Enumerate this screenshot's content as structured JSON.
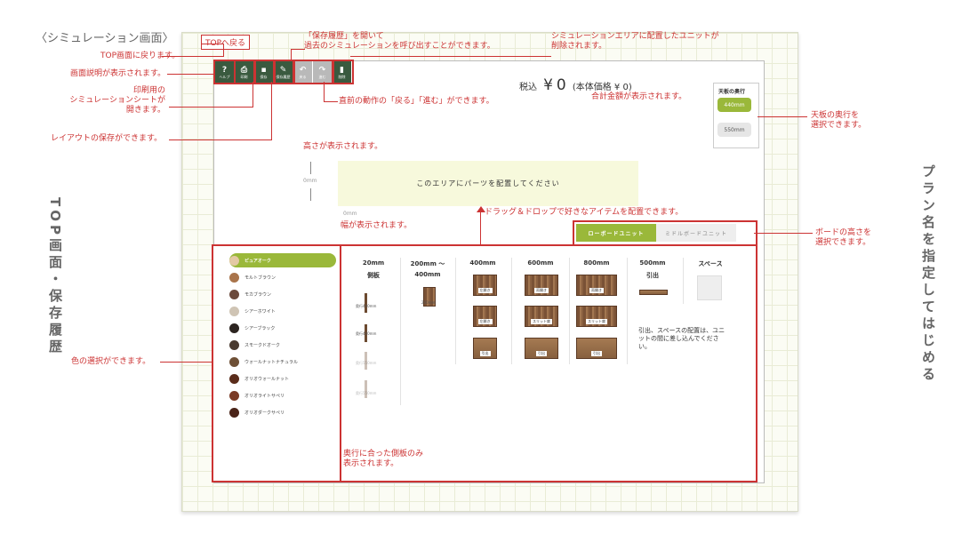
{
  "page_title": "〈シミュレーション画面〉",
  "left_vertical_label": "TOP画面・保存履歴",
  "right_vertical_label": "プラン名を指定してはじめる",
  "top_button": "TOPへ戻る",
  "toolbar": [
    {
      "icon": "help-icon",
      "glyph": "?",
      "label": "ヘルプ"
    },
    {
      "icon": "print-icon",
      "glyph": "⎙",
      "label": "印刷"
    },
    {
      "icon": "save-icon",
      "glyph": "▪",
      "label": "保存"
    },
    {
      "icon": "history-icon",
      "glyph": "✎",
      "label": "保存履歴"
    },
    {
      "icon": "undo-icon",
      "glyph": "↶",
      "label": "戻る"
    },
    {
      "icon": "redo-icon",
      "glyph": "↷",
      "label": "進む"
    },
    {
      "icon": "trash-icon",
      "glyph": "▮",
      "label": "削除"
    }
  ],
  "price": {
    "prefix": "税込",
    "symbol": "¥",
    "value": "0",
    "detail": "(本体価格 ¥ 0)"
  },
  "depth": {
    "title": "天板の奥行",
    "option1": "440mm",
    "option2": "550mm"
  },
  "canvas": {
    "height_label": "0mm",
    "width_label": "0mm",
    "drop_text": "このエリアにパーツを配置してください"
  },
  "tabs": [
    "ローボードユニット",
    "ミドルボードユニット"
  ],
  "colors": [
    {
      "name": "ピュアオーク",
      "color": "#e3c9a4"
    },
    {
      "name": "モルトブラウン",
      "color": "#a9744b"
    },
    {
      "name": "モカブラウン",
      "color": "#6b4a3c"
    },
    {
      "name": "シアーホワイト",
      "color": "#cfc4b4"
    },
    {
      "name": "シアーブラック",
      "color": "#2c2420"
    },
    {
      "name": "スモークドオーク",
      "color": "#4a3a30"
    },
    {
      "name": "ウォールナットナチュラル",
      "color": "#6e5036"
    },
    {
      "name": "オリオウォールナット",
      "color": "#5a2c1a"
    },
    {
      "name": "オリオライトサペリ",
      "color": "#7a3a24"
    },
    {
      "name": "オリオダークサペリ",
      "color": "#4a2418"
    }
  ],
  "parts": {
    "headers": [
      "20mm",
      "200mm ～",
      "400mm",
      "600mm",
      "800mm",
      "500mm",
      "スペース"
    ],
    "sub_headers": [
      "側板",
      "400mm",
      "引出"
    ],
    "side_labels": [
      "奥行440mm",
      "奥行440mm",
      "奥行550mm",
      "奥行550mm"
    ],
    "board_label": "200mm",
    "unit_labels": {
      "r1": [
        "左開き",
        "両開き",
        "両開き"
      ],
      "r2": [
        "左開き",
        "スリット扉",
        "スリット扉"
      ],
      "r3": [
        "引出",
        "引出",
        "引出"
      ]
    },
    "note": "引出、スペースの配置は、ユニットの間に差し込んでください。"
  },
  "annotations": {
    "top": "TOP画面に戻ります。",
    "help": "画面説明が表示されます。",
    "print": "印刷用の\nシミュレーションシートが\n開きます。",
    "save": "レイアウトの保存ができます。",
    "history": "「保存履歴」を開いて\n過去のシミュレーションを呼び出すことができます。",
    "trash": "シミュレーションエリアに配置したユニットが\n削除されます。",
    "undo": "直前の動作の「戻る」「進む」ができます。",
    "total": "合計金額が表示されます。",
    "depth": "天板の奥行を\n選択できます。",
    "height": "高さが表示されます。",
    "width": "幅が表示されます。",
    "drag": "ドラッグ＆ドロップで好きなアイテムを配置できます。",
    "board": "ボードの高さを\n選択できます。",
    "color": "色の選択ができます。",
    "side": "奥行に合った側板のみ\n表示されます。"
  }
}
